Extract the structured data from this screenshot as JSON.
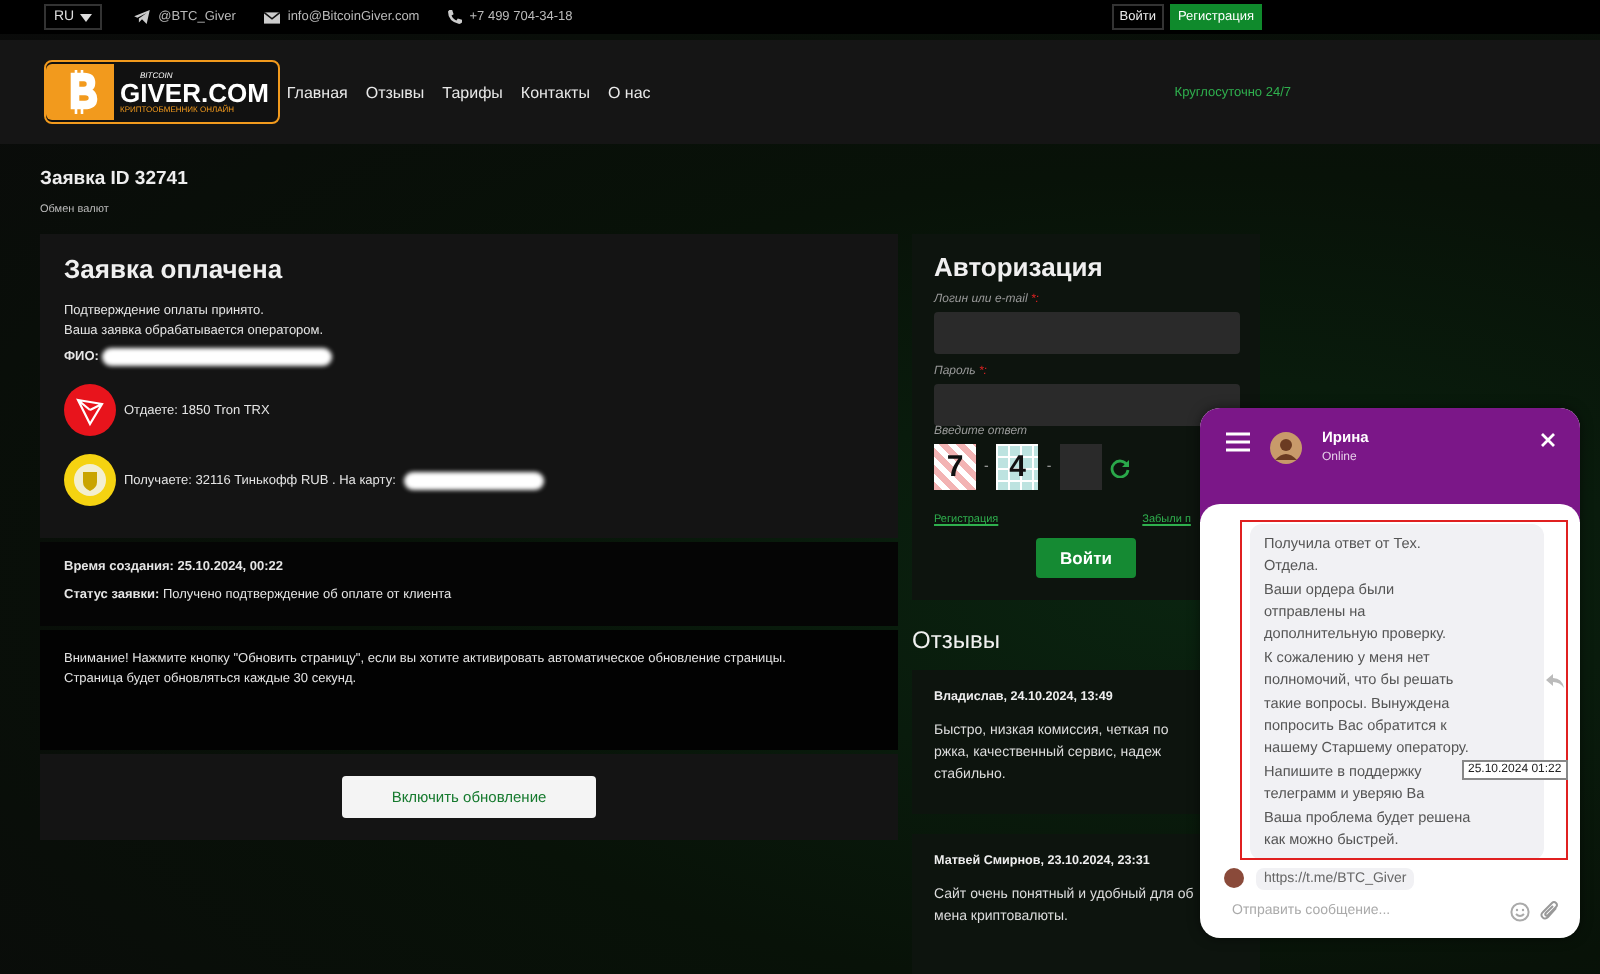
{
  "top_bar": {
    "language": "RU",
    "telegram": "@BTC_Giver",
    "email": "info@BitcoinGiver.com",
    "phone": "+7 499 704-34-18",
    "login_button": "Войти",
    "register_button": "Регистрация"
  },
  "header": {
    "logo": {
      "small": "BITCOIN",
      "name": "GIVER.COM",
      "tagline": "КРИПТООБМЕННИК ОНЛАЙН"
    },
    "nav": [
      "Главная",
      "Отзывы",
      "Тарифы",
      "Контакты",
      "О нас"
    ],
    "hours": "Круглосуточно 24/7"
  },
  "page": {
    "title": "Заявка ID 32741",
    "breadcrumb": "Обмен валют"
  },
  "order": {
    "heading": "Заявка оплачена",
    "messages": [
      "Подтверждение оплаты принято.",
      "Ваша заявка обрабатывается оператором."
    ],
    "fio": {
      "label": "ФИО:",
      "redacted": true
    },
    "lines": [
      {
        "kind": "tron",
        "text": "Отдаете: 1850 Tron TRX",
        "redacted": false
      },
      {
        "kind": "tinkoff",
        "text": "Получаете: 32116 Тинькофф RUB . На карту:",
        "redacted": true
      }
    ],
    "created": {
      "label": "Время создания:",
      "value": "25.10.2024, 00:22"
    },
    "status": {
      "label": "Статус заявки:",
      "value": "Получено подтверждение об оплате от клиента"
    },
    "notice": [
      "Внимание! Нажмите кнопку \"Обновить страницу\", если вы хотите активировать автоматическое обновление страницы.",
      "Страница будет обновляться каждые 30 секунд."
    ],
    "refresh_button": "Включить обновление"
  },
  "auth": {
    "title": "Авторизация",
    "fields": [
      {
        "label": "Логин или e-mail",
        "required_mark": "*:"
      },
      {
        "label": "Пароль",
        "required_mark": "*:"
      }
    ],
    "captcha": {
      "label": "Введите ответ",
      "first": "7",
      "second": "4",
      "signs": [
        "-",
        "-"
      ]
    },
    "links": [
      "Регистрация",
      "Забыли п"
    ],
    "submit": "Войти"
  },
  "reviews": {
    "title": "Отзывы",
    "items": [
      {
        "title": "Владислав, 24.10.2024, 13:49",
        "lines": [
          "Быстро, низкая комиссия, четкая по",
          "ржка, качественный сервис, надеж",
          "стабильно."
        ]
      },
      {
        "title": "Матвей Смирнов, 23.10.2024, 23:31",
        "lines": [
          "Сайт очень понятный и удобный для об",
          "мена криптовалюты."
        ]
      }
    ]
  },
  "chat": {
    "agent": "Ирина",
    "status": "Online",
    "message_lines": [
      "Получила ответ от Тех.",
      "Отдела.",
      "Ваши ордера были",
      "отправлены на",
      "дополнительную проверку.",
      "К сожалению у меня нет",
      "полномочий, что бы решать",
      "такие вопросы. Вынуждена",
      "попросить Вас обратится к",
      "нашему Старшему оператору.",
      "Напишите в поддержку",
      "телеграмм и уверяю Ва",
      "Ваша проблема будет решена",
      "как можно быстрей."
    ],
    "timestamp": "25.10.2024 01:22",
    "link": "https://t.me/BTC_Giver",
    "placeholder": "Отправить сообщение..."
  }
}
